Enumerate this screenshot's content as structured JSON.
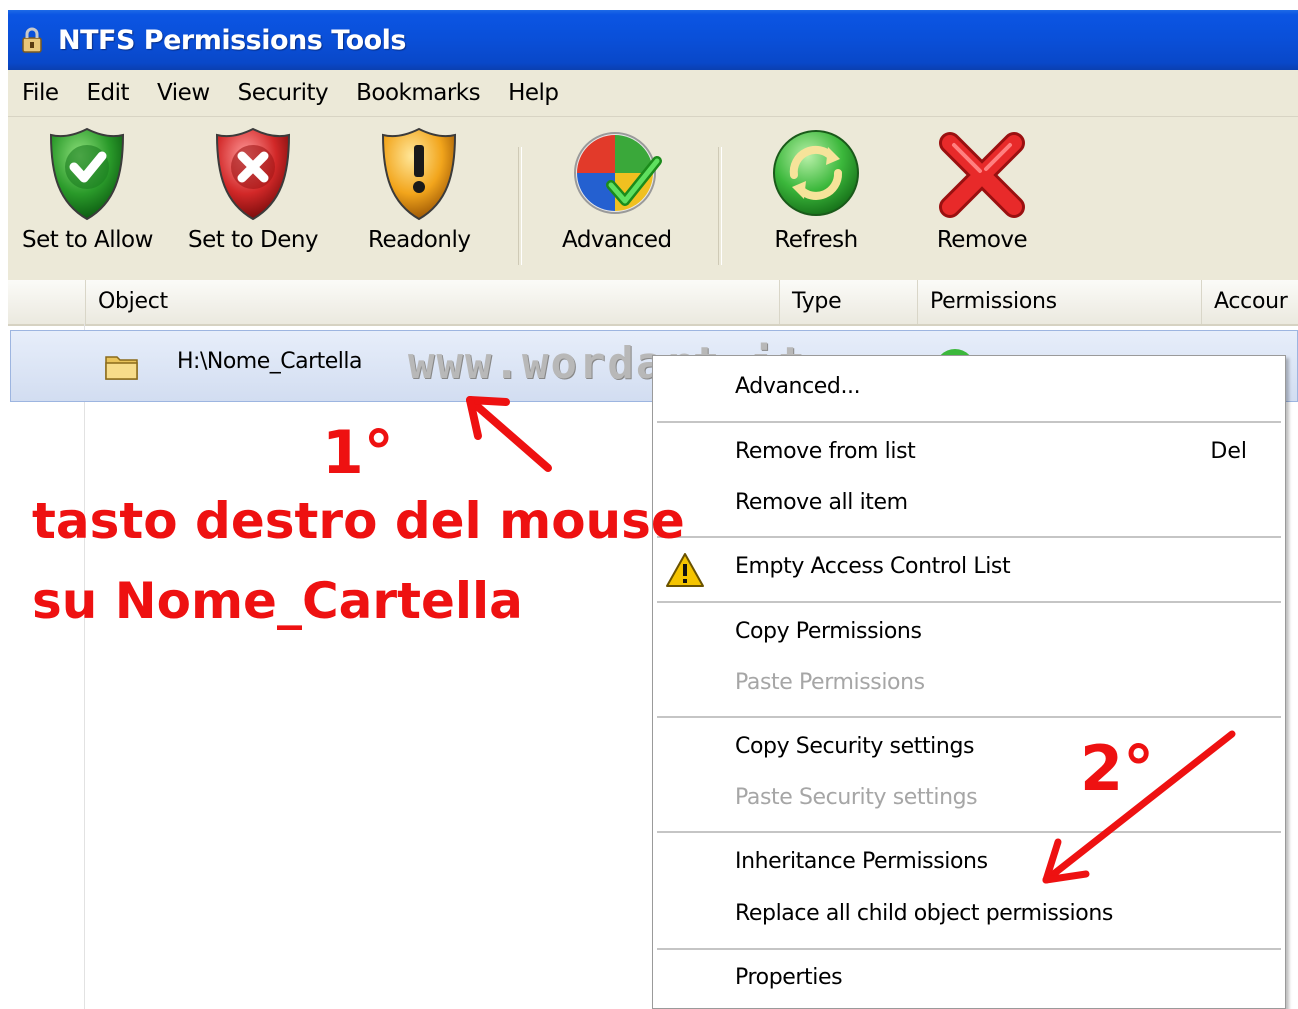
{
  "window": {
    "title": "NTFS Permissions Tools"
  },
  "menubar": {
    "items": [
      {
        "label": "File"
      },
      {
        "label": "Edit"
      },
      {
        "label": "View"
      },
      {
        "label": "Security"
      },
      {
        "label": "Bookmarks"
      },
      {
        "label": "Help"
      }
    ]
  },
  "toolbar": {
    "allow_label": "Set to Allow",
    "deny_label": "Set to Deny",
    "readonly_label": "Readonly",
    "advanced_label": "Advanced",
    "refresh_label": "Refresh",
    "remove_label": "Remove"
  },
  "list": {
    "columns": [
      "Object",
      "Type",
      "Permissions",
      "Accour"
    ],
    "rows": [
      {
        "object": "H:\\Nome_Cartella"
      }
    ]
  },
  "watermark": "www.wordart.it",
  "context_menu": {
    "advanced": "Advanced...",
    "remove_from_list": "Remove from list",
    "remove_shortcut": "Del",
    "remove_all": "Remove all item",
    "empty_acl": "Empty Access Control List",
    "copy_permissions": "Copy Permissions",
    "paste_permissions": "Paste Permissions",
    "copy_security": "Copy Security settings",
    "paste_security": "Paste Security settings",
    "inheritance": "Inheritance Permissions",
    "replace_child": "Replace all child object permissions",
    "properties": "Properties"
  },
  "annotations": {
    "step1": "1°",
    "line1": "tasto destro del mouse",
    "line2": "su Nome_Cartella",
    "step2": "2°",
    "color": "#ee1111"
  },
  "colors": {
    "titlebar": "#0a4fd8",
    "chrome": "#ece9d8",
    "selection": "#d2ddf1"
  }
}
